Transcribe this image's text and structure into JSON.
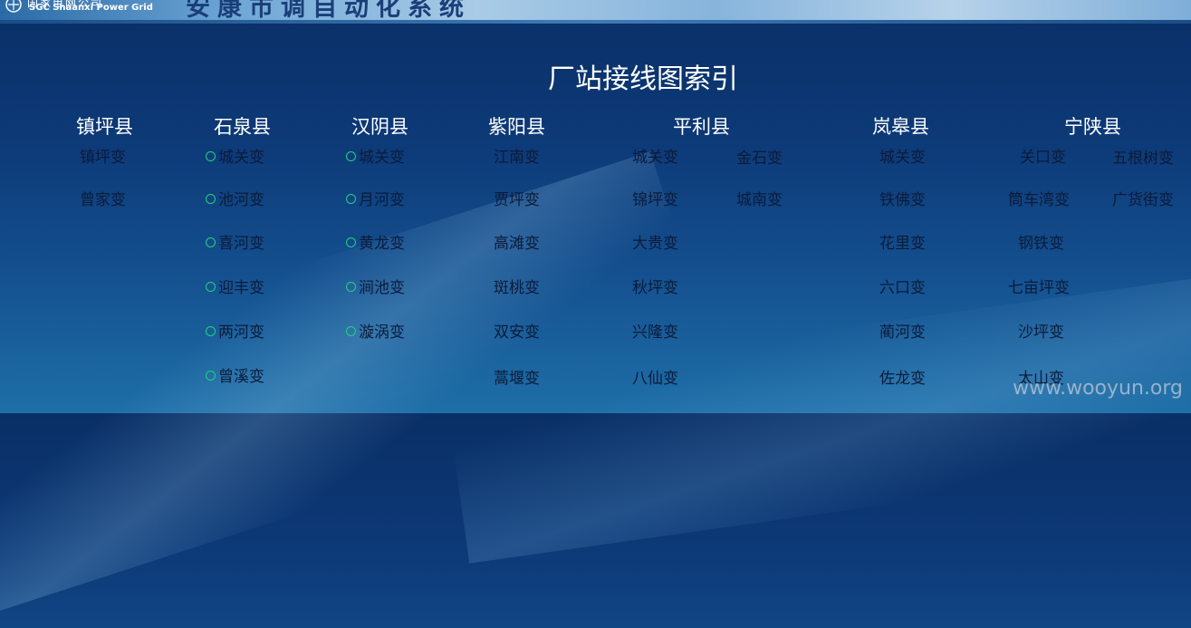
{
  "header": {
    "logo_cn": "国家电网公司",
    "logo_en": "SGC Shaanxi Power Grid",
    "system_title": "安康市调自动化系统"
  },
  "page": {
    "title": "厂站接线图索引"
  },
  "counties": [
    {
      "name": "镇坪县"
    },
    {
      "name": "石泉县"
    },
    {
      "name": "汉阴县"
    },
    {
      "name": "紫阳县"
    },
    {
      "name": "平利县"
    },
    {
      "name": "岚皋县"
    },
    {
      "name": "宁陕县"
    }
  ],
  "stations": {
    "zhenping": [
      "镇坪变",
      "曾家变"
    ],
    "shiquan": [
      "城关变",
      "池河变",
      "喜河变",
      "迎丰变",
      "两河变",
      "曾溪变"
    ],
    "hanyin": [
      "城关变",
      "月河变",
      "黄龙变",
      "涧池变",
      "漩涡变"
    ],
    "ziyang": [
      "江南变",
      "贾坪变",
      "高滩变",
      "斑桃变",
      "双安变",
      "蒿堰变"
    ],
    "pingli_col1": [
      "城关变",
      "锦坪变",
      "大贵变",
      "秋坪变",
      "兴隆变",
      "八仙变"
    ],
    "pingli_col2": [
      "金石变",
      "城南变"
    ],
    "langao": [
      "城关变",
      "铁佛变",
      "花里变",
      "六口变",
      "蔺河变",
      "佐龙变"
    ],
    "ningshan_col1": [
      "关口变",
      "筒车湾变",
      "钢铁变",
      "七亩坪变",
      "沙坪变",
      "太山变"
    ],
    "ningshan_col2": [
      "五根树变",
      "广货街变"
    ]
  },
  "watermark": "www.wooyun.org",
  "colors": {
    "background_top": "#0a2f66",
    "background_bottom": "#1e6fa8",
    "station_text": "#0b1b3a",
    "status_ring": "#1fd37a",
    "heading_text": "#ffffff"
  },
  "icons": {
    "logo": "sgcc-logo-icon",
    "status": "status-ring-icon"
  }
}
